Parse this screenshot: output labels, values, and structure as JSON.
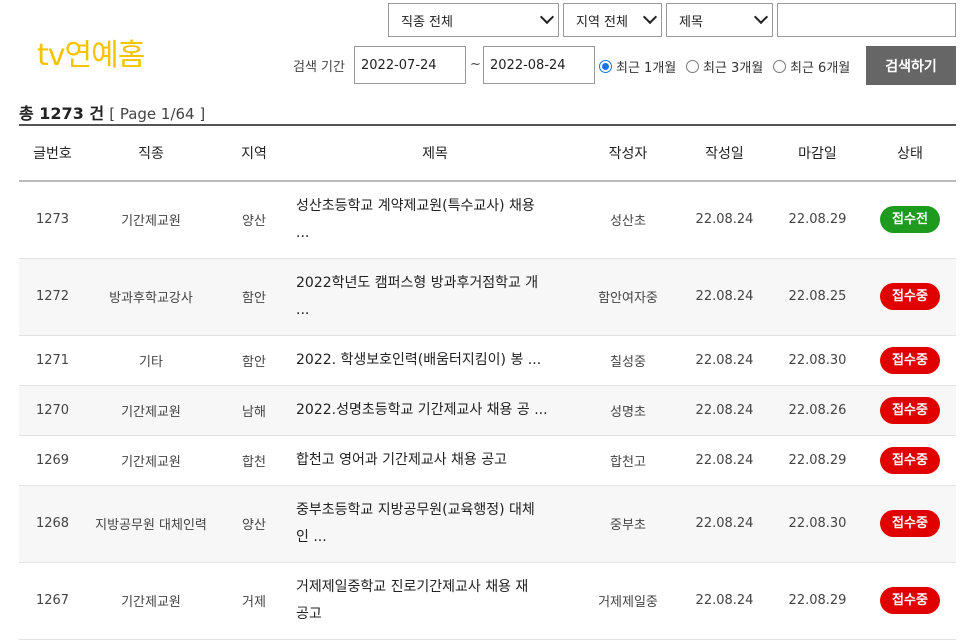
{
  "logo": "tv연예홈",
  "filters": {
    "category": "직종 전체",
    "region": "지역 전체",
    "field": "제목",
    "keyword": ""
  },
  "period": {
    "label": "검색 기간",
    "from": "2022-07-24",
    "sep": "~",
    "to": "2022-08-24",
    "options": [
      "최근 1개월",
      "최근 3개월",
      "최근 6개월"
    ],
    "selected": 0
  },
  "search_button": "검색하기",
  "summary": {
    "total": "총 1273 건",
    "page": "[ Page 1/64 ]"
  },
  "columns": [
    "글번호",
    "직종",
    "지역",
    "제목",
    "작성자",
    "작성일",
    "마감일",
    "상태"
  ],
  "rows": [
    {
      "no": "1273",
      "job": "기간제교원",
      "region": "양산",
      "title_l1": "성산초등학교 계약제교원(특수교사) 채용",
      "title_l2": "...",
      "author": "성산초",
      "date": "22.08.24",
      "deadline": "22.08.29",
      "status": "접수전",
      "tall": true
    },
    {
      "no": "1272",
      "job": "방과후학교강사",
      "region": "함안",
      "title_l1": "2022학년도 캠퍼스형 방과후거점학교 개",
      "title_l2": "...",
      "author": "함안여자중",
      "date": "22.08.24",
      "deadline": "22.08.25",
      "status": "접수중",
      "tall": true
    },
    {
      "no": "1271",
      "job": "기타",
      "region": "함안",
      "title_l1": "2022. 학생보호인력(배움터지킴이) 봉 ...",
      "title_l2": "",
      "author": "칠성중",
      "date": "22.08.24",
      "deadline": "22.08.30",
      "status": "접수중",
      "tall": false
    },
    {
      "no": "1270",
      "job": "기간제교원",
      "region": "남해",
      "title_l1": "2022.성명초등학교 기간제교사 채용 공 ...",
      "title_l2": "",
      "author": "성명초",
      "date": "22.08.24",
      "deadline": "22.08.26",
      "status": "접수중",
      "tall": false
    },
    {
      "no": "1269",
      "job": "기간제교원",
      "region": "합천",
      "title_l1": "합천고 영어과 기간제교사 채용 공고",
      "title_l2": "",
      "author": "합천고",
      "date": "22.08.24",
      "deadline": "22.08.29",
      "status": "접수중",
      "tall": false
    },
    {
      "no": "1268",
      "job": "지방공무원 대체인력",
      "region": "양산",
      "title_l1": "중부초등학교 지방공무원(교육행정) 대체",
      "title_l2": "인 ...",
      "author": "중부초",
      "date": "22.08.24",
      "deadline": "22.08.30",
      "status": "접수중",
      "tall": true
    },
    {
      "no": "1267",
      "job": "기간제교원",
      "region": "거제",
      "title_l1": "거제제일중학교 진로기간제교사 채용 재",
      "title_l2": "공고",
      "author": "거제제일중",
      "date": "22.08.24",
      "deadline": "22.08.29",
      "status": "접수중",
      "tall": true
    }
  ],
  "status_colors": {
    "접수전": "#1e9b1e",
    "접수중": "#e00000"
  }
}
